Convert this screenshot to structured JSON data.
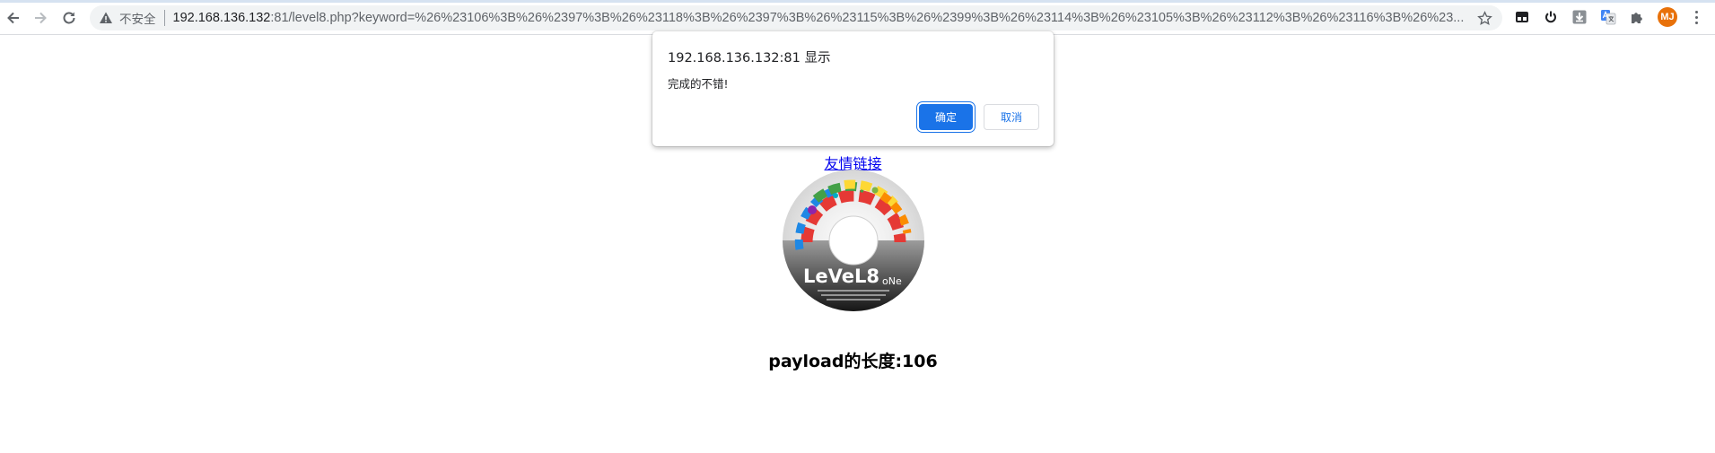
{
  "browser": {
    "security_label": "不安全",
    "url_host": "192.168.136.132",
    "url_rest": ":81/level8.php?keyword=%26%23106%3B%26%2397%3B%26%23118%3B%26%2397%3B%26%23115%3B%26%2399%3B%26%23114%3B%26%23105%3B%26%23112%3B%26%23116%3B%26%23...",
    "profile_initials": "MJ",
    "profile_color": "#e8710a"
  },
  "page": {
    "friend_link": "友情链接",
    "disc_title": "LeVeL8",
    "disc_subtitle": "oNe",
    "payload_heading": "payload的长度:106"
  },
  "dialog": {
    "title": "192.168.136.132:81 显示",
    "message": "完成的不错!",
    "ok_label": "确定",
    "cancel_label": "取消",
    "accent": "#1a73e8"
  }
}
